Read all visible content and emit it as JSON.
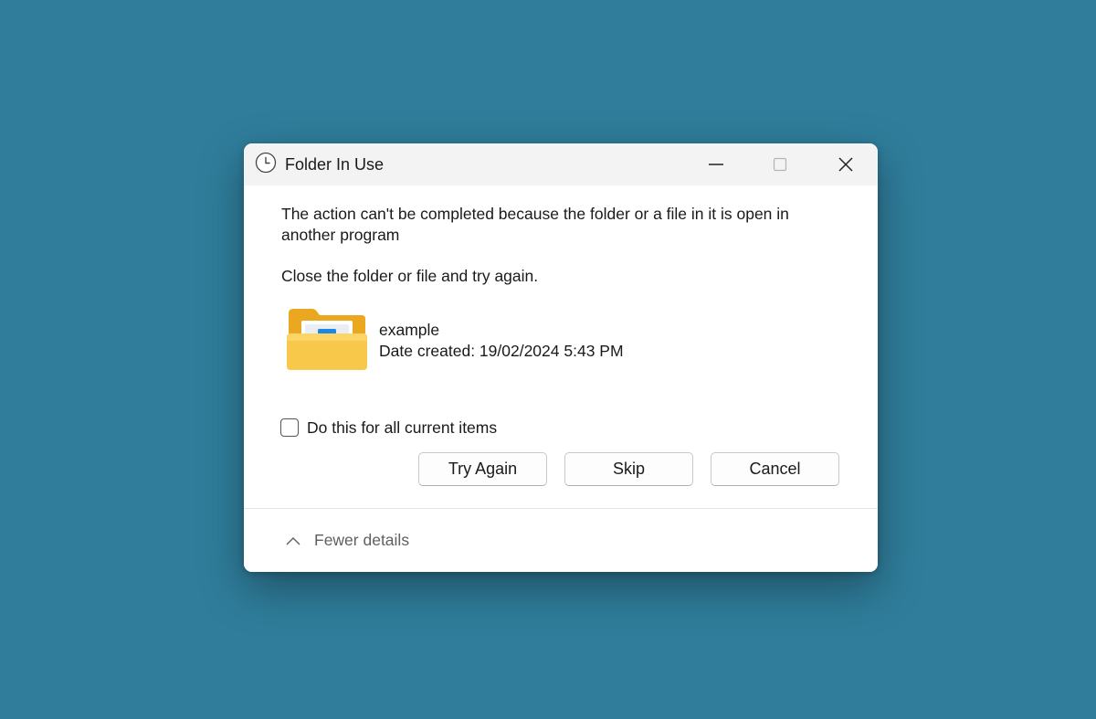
{
  "window": {
    "title": "Folder In Use",
    "title_icon": "clock-icon",
    "controls": [
      "minimize-icon",
      "maximize-icon",
      "close-icon"
    ]
  },
  "message": {
    "text": "The action can't be completed because the folder or a file in it is open in another program",
    "instruction": "Close the folder or file and try again."
  },
  "item": {
    "icon": "folder-icon",
    "name": "example",
    "date_created": "Date created: 19/02/2024 5:43 PM"
  },
  "checkbox": {
    "label": "Do this for all current items",
    "checked": false
  },
  "buttons": {
    "try_again": "Try Again",
    "skip": "Skip",
    "cancel": "Cancel"
  },
  "footer": {
    "details_label": "Fewer details",
    "icon": "chevron-up-icon"
  },
  "colors": {
    "desktop_background": "#2f7d9b",
    "folder_yellow": "#f8c84a",
    "folder_accent": "#1e88e5"
  }
}
